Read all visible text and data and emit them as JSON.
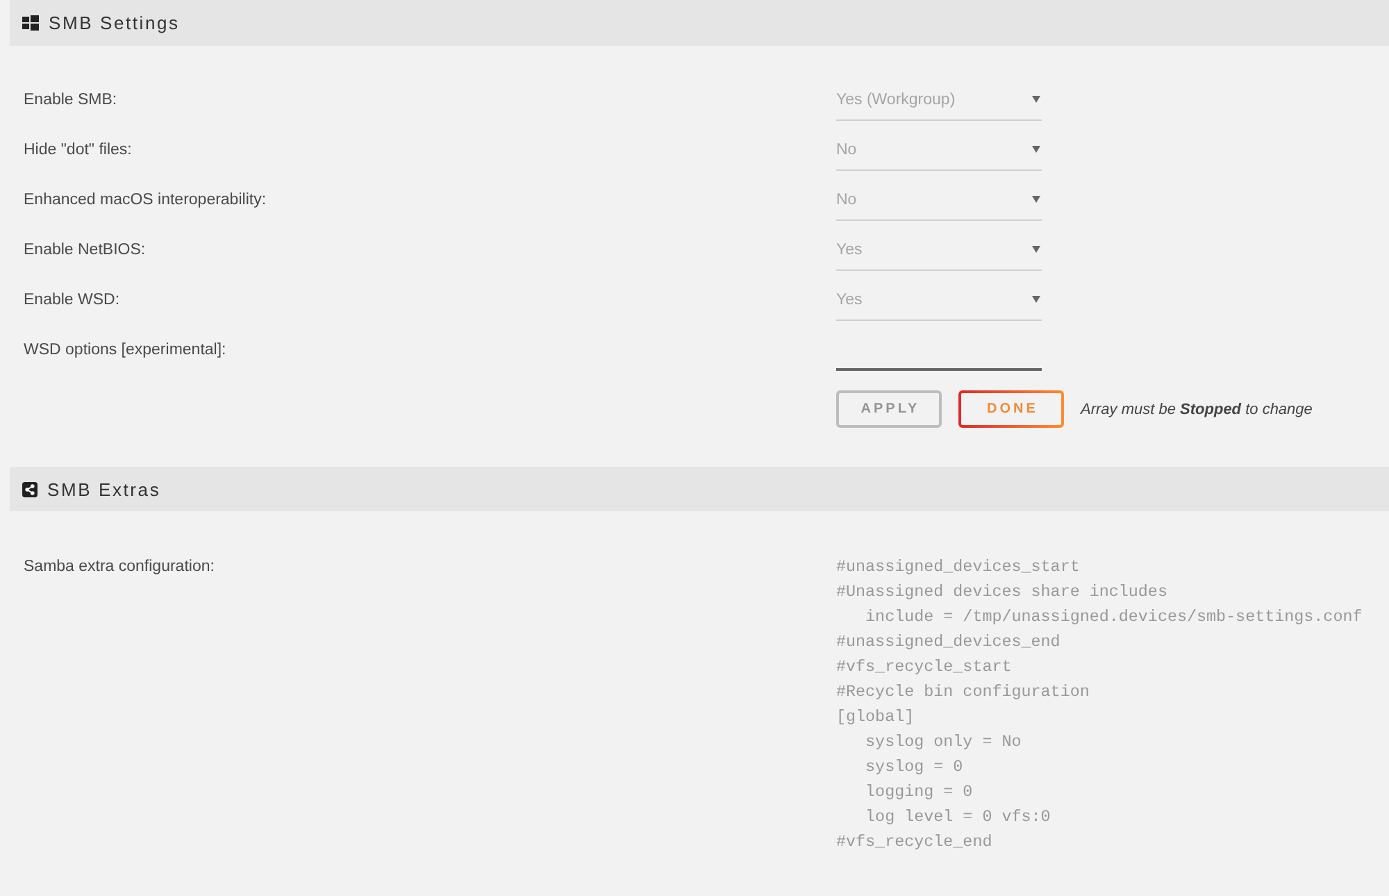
{
  "smb_settings": {
    "title": "SMB Settings",
    "settings": [
      {
        "label": "Enable SMB:",
        "kind": "select",
        "value": "Yes (Workgroup)",
        "disabled": true
      },
      {
        "label": "Hide \"dot\" files:",
        "kind": "select",
        "value": "No",
        "disabled": true
      },
      {
        "label": "Enhanced macOS interoperability:",
        "kind": "select",
        "value": "No",
        "disabled": true
      },
      {
        "label": "Enable NetBIOS:",
        "kind": "select",
        "value": "Yes",
        "disabled": true
      },
      {
        "label": "Enable WSD:",
        "kind": "select",
        "value": "Yes",
        "disabled": true
      },
      {
        "label": "WSD options [experimental]:",
        "kind": "input"
      }
    ],
    "buttons": [
      {
        "label": "APPLY",
        "disabled": true
      },
      {
        "label": "DONE",
        "disabled": false
      }
    ],
    "note": "Array must be **Stopped** to change"
  },
  "smb_extras": {
    "title": "SMB Extras",
    "label": "Samba extra configuration:",
    "value": "#unassigned_devices_start\n#Unassigned devices share includes\n   include = /tmp/unassigned.devices/smb-settings.conf\n#unassigned_devices_end\n#vfs_recycle_start\n#Recycle bin configuration\n[global]\n   syslog only = No\n   syslog = 0\n   logging = 0\n   log level = 0 vfs:0\n#vfs_recycle_end"
  }
}
